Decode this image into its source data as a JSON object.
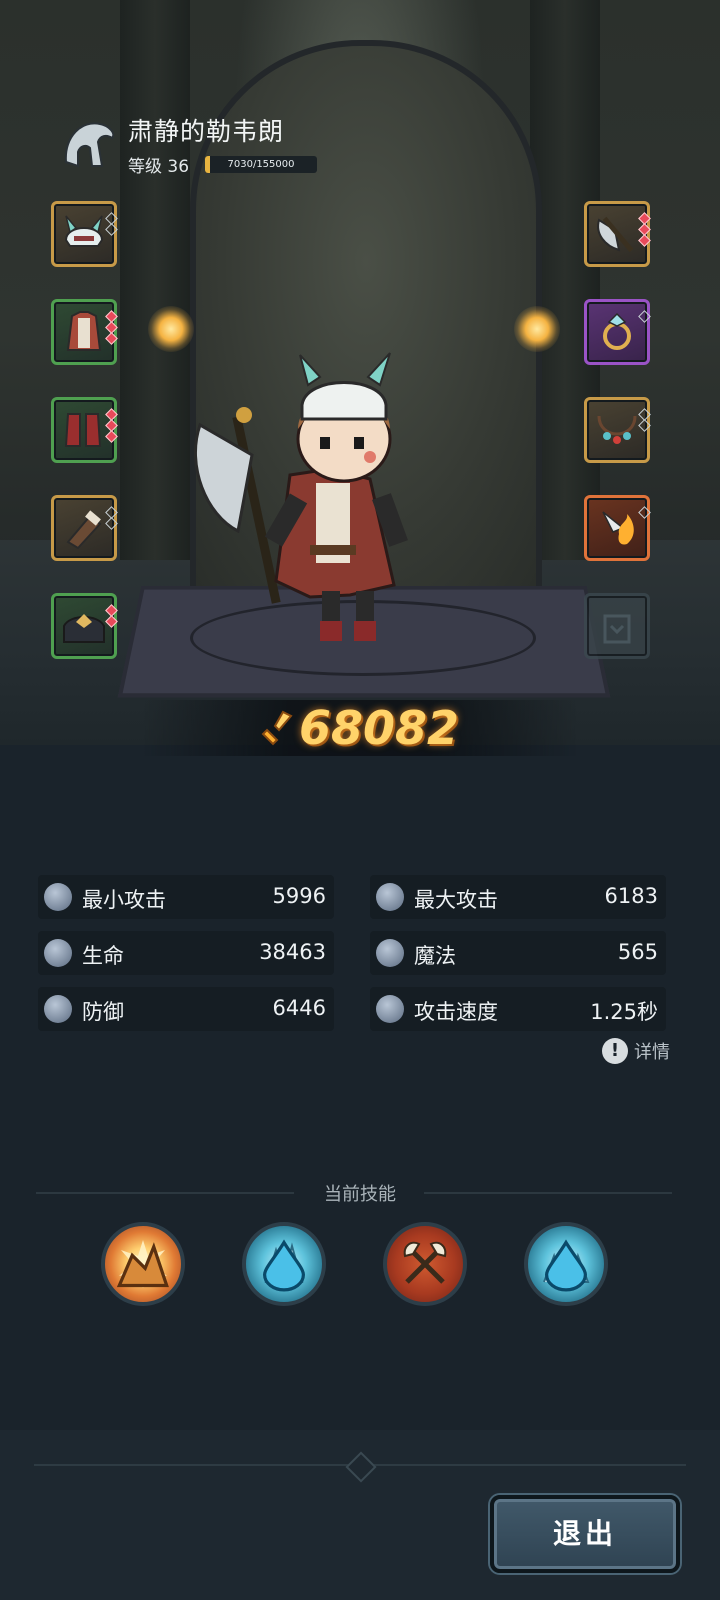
{
  "player": {
    "name": "肃静的勒韦朗",
    "level_label": "等级 36",
    "exp_text": "7030/155000",
    "exp_fraction": 0.045
  },
  "equipment": {
    "left": [
      {
        "name": "helmet",
        "rarity": "gold"
      },
      {
        "name": "armor",
        "rarity": "green"
      },
      {
        "name": "boots",
        "rarity": "green"
      },
      {
        "name": "gloves",
        "rarity": "gold"
      },
      {
        "name": "shoulder",
        "rarity": "green"
      }
    ],
    "right": [
      {
        "name": "weapon-axe",
        "rarity": "gold"
      },
      {
        "name": "ring",
        "rarity": "purple"
      },
      {
        "name": "necklace",
        "rarity": "gold"
      },
      {
        "name": "fire-charm",
        "rarity": "orange"
      },
      {
        "name": "locked-slot",
        "rarity": "empty"
      }
    ]
  },
  "power": {
    "value": "68082",
    "icon": "sword-power-icon"
  },
  "stats": [
    {
      "label": "最小攻击",
      "value": "5996",
      "icon": "sword-icon"
    },
    {
      "label": "最大攻击",
      "value": "6183",
      "icon": "sword-icon"
    },
    {
      "label": "生命",
      "value": "38463",
      "icon": "heart-icon"
    },
    {
      "label": "魔法",
      "value": "565",
      "icon": "magic-icon"
    },
    {
      "label": "防御",
      "value": "6446",
      "icon": "shield-icon"
    },
    {
      "label": "攻击速度",
      "value": "1.25秒",
      "icon": "speed-icon"
    }
  ],
  "details_label": "详情",
  "skills": {
    "title": "当前技能",
    "items": [
      {
        "name": "explosion-skill",
        "type": "fire"
      },
      {
        "name": "ice-crystal-skill",
        "type": "ice"
      },
      {
        "name": "crossed-axes-skill",
        "type": "axe"
      },
      {
        "name": "ice-spikes-skill",
        "type": "ice"
      }
    ]
  },
  "exit_label": "退出",
  "colors": {
    "background": "#1a232b",
    "power_text": "#ffd36a",
    "exp_fill": "#e8b440",
    "button": "#3a5060"
  }
}
